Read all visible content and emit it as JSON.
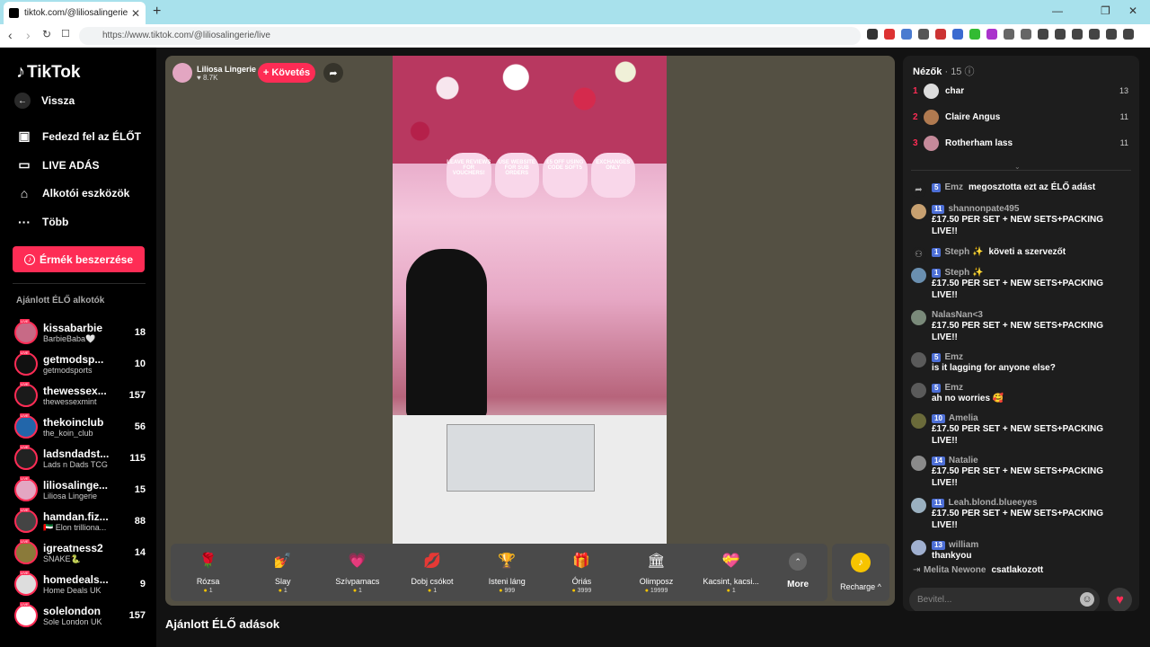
{
  "browser": {
    "tab_title": "tiktok.com/@liliosalingerie/li...",
    "url": "https://www.tiktok.com/@liliosalingerie/live"
  },
  "sidebar": {
    "logo": "TikTok",
    "back": "Vissza",
    "nav": [
      {
        "label": "Fedezd fel az ÉLŐT",
        "icon": "live-explore-icon"
      },
      {
        "label": "LIVE ADÁS",
        "icon": "camera-icon"
      },
      {
        "label": "Alkotói eszközök",
        "icon": "creator-tools-icon"
      },
      {
        "label": "Több",
        "icon": "more-dots-icon"
      }
    ],
    "coin_button": "Érmék beszerzése",
    "section_title": "Ajánlott ÉLŐ alkotók",
    "creators": [
      {
        "name": "kissabarbie",
        "sub": "BarbieBaba🤍",
        "count": "18",
        "color": "#c76a86"
      },
      {
        "name": "getmodsp...",
        "sub": "getmodsports",
        "count": "10",
        "color": "#111111"
      },
      {
        "name": "thewessex...",
        "sub": "thewessexmint",
        "count": "157",
        "color": "#1a1a1a"
      },
      {
        "name": "thekoinclub",
        "sub": "the_koin_club",
        "count": "56",
        "color": "#2266aa"
      },
      {
        "name": "ladsndadst...",
        "sub": "Lads n Dads TCG",
        "count": "115",
        "color": "#222222"
      },
      {
        "name": "liliosalinge...",
        "sub": "Liliosa Lingerie",
        "count": "15",
        "color": "#e3a6c2"
      },
      {
        "name": "hamdan.fiz...",
        "sub": "🇦🇪 Elon trilliona...",
        "count": "88",
        "color": "#444444"
      },
      {
        "name": "igreatness2",
        "sub": "SNAKE🐍",
        "count": "14",
        "color": "#8a7a3a"
      },
      {
        "name": "homedeals...",
        "sub": "Home Deals UK",
        "count": "9",
        "color": "#dddddd"
      },
      {
        "name": "solelondon",
        "sub": "Sole London UK",
        "count": "157",
        "color": "#ffffff"
      }
    ]
  },
  "stage": {
    "streamer_name": "Liliosa Lingerie",
    "likes": "♥ 8.7K",
    "follow_label": "+ Követés",
    "signs": [
      "LEAVE REVIEWS FOR VOUCHERS!",
      "USE WEBSITE FOR SUB ORDERS",
      "£5 OFF USING CODE SOFT5",
      "EXCHANGES ONLY"
    ],
    "gifts": [
      {
        "name": "Rózsa",
        "price": "1",
        "icon": "rose-icon",
        "glyph": "🌹"
      },
      {
        "name": "Slay",
        "price": "1",
        "icon": "slay-icon",
        "glyph": "💅"
      },
      {
        "name": "Szívpamacs",
        "price": "1",
        "icon": "heart-puff-icon",
        "glyph": "💗"
      },
      {
        "name": "Dobj csókot",
        "price": "1",
        "icon": "kiss-icon",
        "glyph": "💋"
      },
      {
        "name": "Isteni láng",
        "price": "999",
        "icon": "divine-flame-icon",
        "glyph": "🏆"
      },
      {
        "name": "Óriás",
        "price": "3999",
        "icon": "giant-icon",
        "glyph": "🎁"
      },
      {
        "name": "Olimposz",
        "price": "19999",
        "icon": "olympus-icon",
        "glyph": "🏛"
      },
      {
        "name": "Kacsint, kacsi...",
        "price": "1",
        "icon": "wink-heart-icon",
        "glyph": "💝"
      }
    ],
    "more_label": "More",
    "recharge_label": "Recharge ^"
  },
  "recommended_title": "Ajánlott ÉLŐ adások",
  "right_panel": {
    "viewers_label": "Nézők",
    "viewers_count": "· 15",
    "top_viewers": [
      {
        "rank": "1",
        "name": "char",
        "score": "13",
        "color": "#dddddd"
      },
      {
        "rank": "2",
        "name": "Claire Angus",
        "score": "11",
        "color": "#b07a50"
      },
      {
        "rank": "3",
        "name": "Rotherham lass",
        "score": "11",
        "color": "#c58a9a"
      }
    ],
    "messages": [
      {
        "badge": "5",
        "user": "Emz",
        "action": "megosztotta ezt az ÉLŐ adást",
        "text": "",
        "color": "#1d1d1d",
        "icon": "share-icon"
      },
      {
        "badge": "11",
        "user": "shannonpate495",
        "action": "",
        "text": "£17.50 PER SET + NEW SETS+PACKING LIVE!!",
        "color": "#c7a070"
      },
      {
        "badge": "1",
        "user": "Steph ✨",
        "action": "követi a szervezőt",
        "text": "",
        "color": "#1d1d1d",
        "icon": "follow-user-icon"
      },
      {
        "badge": "1",
        "user": "Steph ✨",
        "action": "",
        "text": "£17.50 PER SET + NEW SETS+PACKING LIVE!!",
        "color": "#6a8fb0"
      },
      {
        "badge": "",
        "user": "NalasNan<3",
        "action": "",
        "text": "£17.50 PER SET + NEW SETS+PACKING LIVE!!",
        "color": "#7a8a7a"
      },
      {
        "badge": "5",
        "user": "Emz",
        "action": "",
        "text": "is it lagging for anyone else?",
        "color": "#5a5a5a"
      },
      {
        "badge": "5",
        "user": "Emz",
        "action": "",
        "text": "ah no worries 🥰",
        "color": "#5a5a5a"
      },
      {
        "badge": "10",
        "user": "Amelia",
        "action": "",
        "text": "£17.50 PER SET + NEW SETS+PACKING LIVE!!",
        "color": "#6a6a3a"
      },
      {
        "badge": "14",
        "user": "Natalie",
        "action": "",
        "text": "£17.50 PER SET + NEW SETS+PACKING LIVE!!",
        "color": "#8a8a8a"
      },
      {
        "badge": "11",
        "user": "Leah.blond.blueeyes",
        "action": "",
        "text": "£17.50 PER SET + NEW SETS+PACKING LIVE!!",
        "color": "#9ab0c0"
      },
      {
        "badge": "13",
        "user": "william",
        "action": "",
        "text": "thankyou",
        "color": "#a0b0d0"
      }
    ],
    "joined_user": "Melita Newone",
    "joined_action": "csatlakozott",
    "input_placeholder": "Bevitel..."
  }
}
